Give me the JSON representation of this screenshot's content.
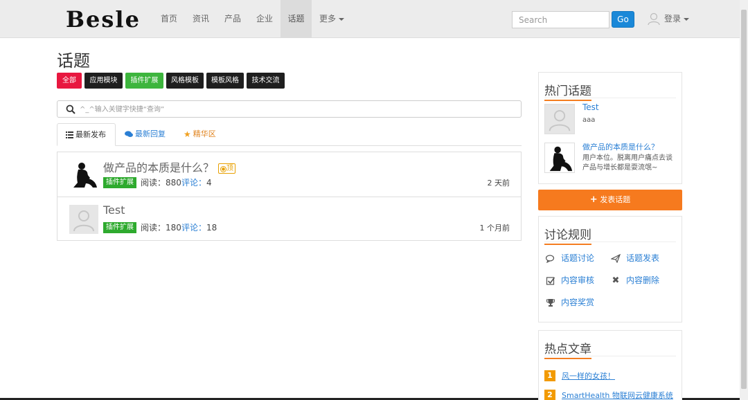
{
  "brand": {
    "logo": "Besle"
  },
  "nav": {
    "items": [
      "首页",
      "资讯",
      "产品",
      "企业",
      "话题"
    ],
    "more": "更多",
    "search_placeholder": "Search",
    "go_label": "Go",
    "login_label": "登录"
  },
  "page": {
    "title": "话题"
  },
  "filters": [
    {
      "label": "全部",
      "color": "#e8173f"
    },
    {
      "label": "应用模块",
      "color": "#1f1f1f"
    },
    {
      "label": "插件扩展",
      "color": "#3db53d"
    },
    {
      "label": "风格模板",
      "color": "#1f1f1f"
    },
    {
      "label": "模板风格",
      "color": "#1f1f1f"
    },
    {
      "label": "技术交流",
      "color": "#1f1f1f"
    }
  ],
  "topic_search": {
    "placeholder": "^_^输入关键字快捷“查询”"
  },
  "tabs": [
    "最新发布",
    "最新回复",
    "精华区"
  ],
  "topics": [
    {
      "title": "做产品的本质是什么？",
      "badge": "顶",
      "category": "插件扩展",
      "views_label": "阅读：880",
      "comments_label": "评论：",
      "comments_count": "4",
      "time": "2 天前"
    },
    {
      "title": "Test",
      "category": "插件扩展",
      "views_label": "阅读：180",
      "comments_label": "评论：",
      "comments_count": "18",
      "time": "1 个月前"
    }
  ],
  "hot_topics": {
    "title": "热门话题",
    "items": [
      {
        "name": "Test",
        "desc": "aaa"
      },
      {
        "name": "做产品的本质是什么？",
        "desc": "用户本位。脱离用户痛点去谈产品与增长都是耍流氓~"
      }
    ]
  },
  "publish_button": {
    "label": "发表话题"
  },
  "rules": {
    "title": "讨论规则",
    "items": [
      {
        "label": "话题讨论",
        "icon": "comments-icon"
      },
      {
        "label": "话题发表",
        "icon": "send-icon"
      },
      {
        "label": "内容审核",
        "icon": "check-square-icon"
      },
      {
        "label": "内容删除",
        "icon": "close-icon"
      },
      {
        "label": "内容奖赏",
        "icon": "trophy-icon"
      }
    ]
  },
  "hot_articles": {
    "title": "热点文章",
    "items": [
      {
        "num": "1",
        "title": "风一样的女孩！"
      },
      {
        "num": "2",
        "title": "SmartHealth 物联网云健康系统"
      }
    ]
  },
  "colors": {
    "accent_orange": "#f67a1e",
    "link_blue": "#2a7fd4",
    "go_blue": "#1a88d8",
    "tag_green": "#3db53d",
    "red": "#e8173f"
  }
}
